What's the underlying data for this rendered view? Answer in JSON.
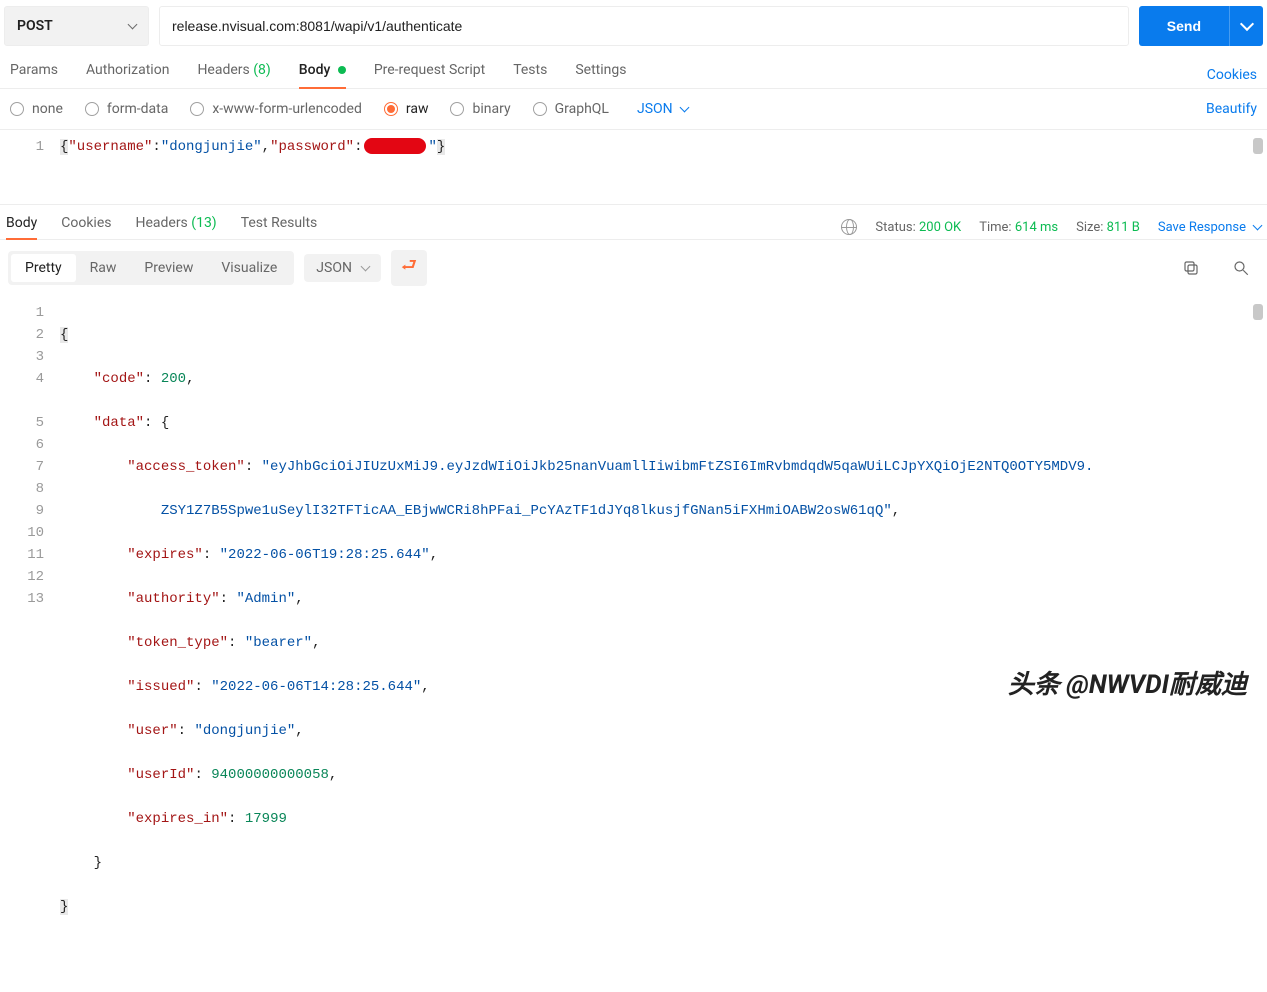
{
  "request": {
    "method": "POST",
    "url": "release.nvisual.com:8081/wapi/v1/authenticate",
    "send_label": "Send"
  },
  "tabs": {
    "items": [
      "Params",
      "Authorization",
      "Headers",
      "Body",
      "Pre-request Script",
      "Tests",
      "Settings"
    ],
    "headers_count": "(8)",
    "active": "Body",
    "cookies_link": "Cookies"
  },
  "body_types": {
    "items": [
      "none",
      "form-data",
      "x-www-form-urlencoded",
      "raw",
      "binary",
      "GraphQL"
    ],
    "selected": "raw",
    "format": "JSON",
    "beautify": "Beautify"
  },
  "request_body": {
    "line_no": "1",
    "username_key": "\"username\"",
    "username_val": "\"dongjunjie\"",
    "password_key": "\"password\"",
    "password_tail": "\""
  },
  "response": {
    "tabs": [
      "Body",
      "Cookies",
      "Headers",
      "Test Results"
    ],
    "headers_count": "(13)",
    "active": "Body",
    "status_label": "Status:",
    "status_value": "200 OK",
    "time_label": "Time:",
    "time_value": "614 ms",
    "size_label": "Size:",
    "size_value": "811 B",
    "save_label": "Save Response"
  },
  "view": {
    "modes": [
      "Pretty",
      "Raw",
      "Preview",
      "Visualize"
    ],
    "active": "Pretty",
    "format": "JSON"
  },
  "response_body": {
    "lines": [
      "1",
      "2",
      "3",
      "4",
      "5",
      "6",
      "7",
      "8",
      "9",
      "10",
      "11",
      "12",
      "13"
    ],
    "code_key": "\"code\"",
    "code_val": "200",
    "data_key": "\"data\"",
    "access_token_key": "\"access_token\"",
    "access_token_val1": "\"eyJhbGciOiJIUzUxMiJ9.eyJzdWIiOiJkb25nanVuamllIiwibmFtZSI6ImRvbmdqdW5qaWUiLCJpYXQiOjE2NTQ0OTY5MDV9.",
    "access_token_val2": "ZSY1Z7B5Spwe1uSeylI32TFTicAA_EBjwWCRi8hPFai_PcYAzTF1dJYq8lkusjfGNan5iFXHmiOABW2osW61qQ\"",
    "expires_key": "\"expires\"",
    "expires_val": "\"2022-06-06T19:28:25.644\"",
    "authority_key": "\"authority\"",
    "authority_val": "\"Admin\"",
    "token_type_key": "\"token_type\"",
    "token_type_val": "\"bearer\"",
    "issued_key": "\"issued\"",
    "issued_val": "\"2022-06-06T14:28:25.644\"",
    "user_key": "\"user\"",
    "user_val": "\"dongjunjie\"",
    "userId_key": "\"userId\"",
    "userId_val": "94000000000058",
    "expires_in_key": "\"expires_in\"",
    "expires_in_val": "17999"
  },
  "watermark": "头条 @NWVDI耐威迪"
}
